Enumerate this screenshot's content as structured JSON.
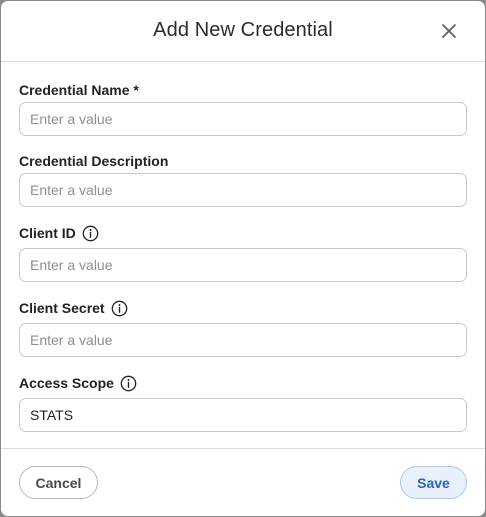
{
  "dialog": {
    "title": "Add New Credential",
    "close_icon": "close-icon"
  },
  "fields": [
    {
      "label": "Credential Name *",
      "placeholder": "Enter a value",
      "value": "",
      "has_info": false
    },
    {
      "label": "Credential Description",
      "placeholder": "Enter a value",
      "value": "",
      "has_info": false
    },
    {
      "label": "Client ID",
      "placeholder": "Enter a value",
      "value": "",
      "has_info": true,
      "icon": "info-icon"
    },
    {
      "label": "Client Secret",
      "placeholder": "Enter a value",
      "value": "",
      "has_info": true,
      "icon": "info-icon"
    },
    {
      "label": "Access Scope",
      "placeholder": "Enter a value",
      "value": "STATS",
      "has_info": true,
      "icon": "info-icon"
    }
  ],
  "footer": {
    "cancel_label": "Cancel",
    "save_label": "Save"
  },
  "colors": {
    "save_bg": "#e8f1fb",
    "save_text": "#2a63b8",
    "border": "#c9c9c9"
  }
}
